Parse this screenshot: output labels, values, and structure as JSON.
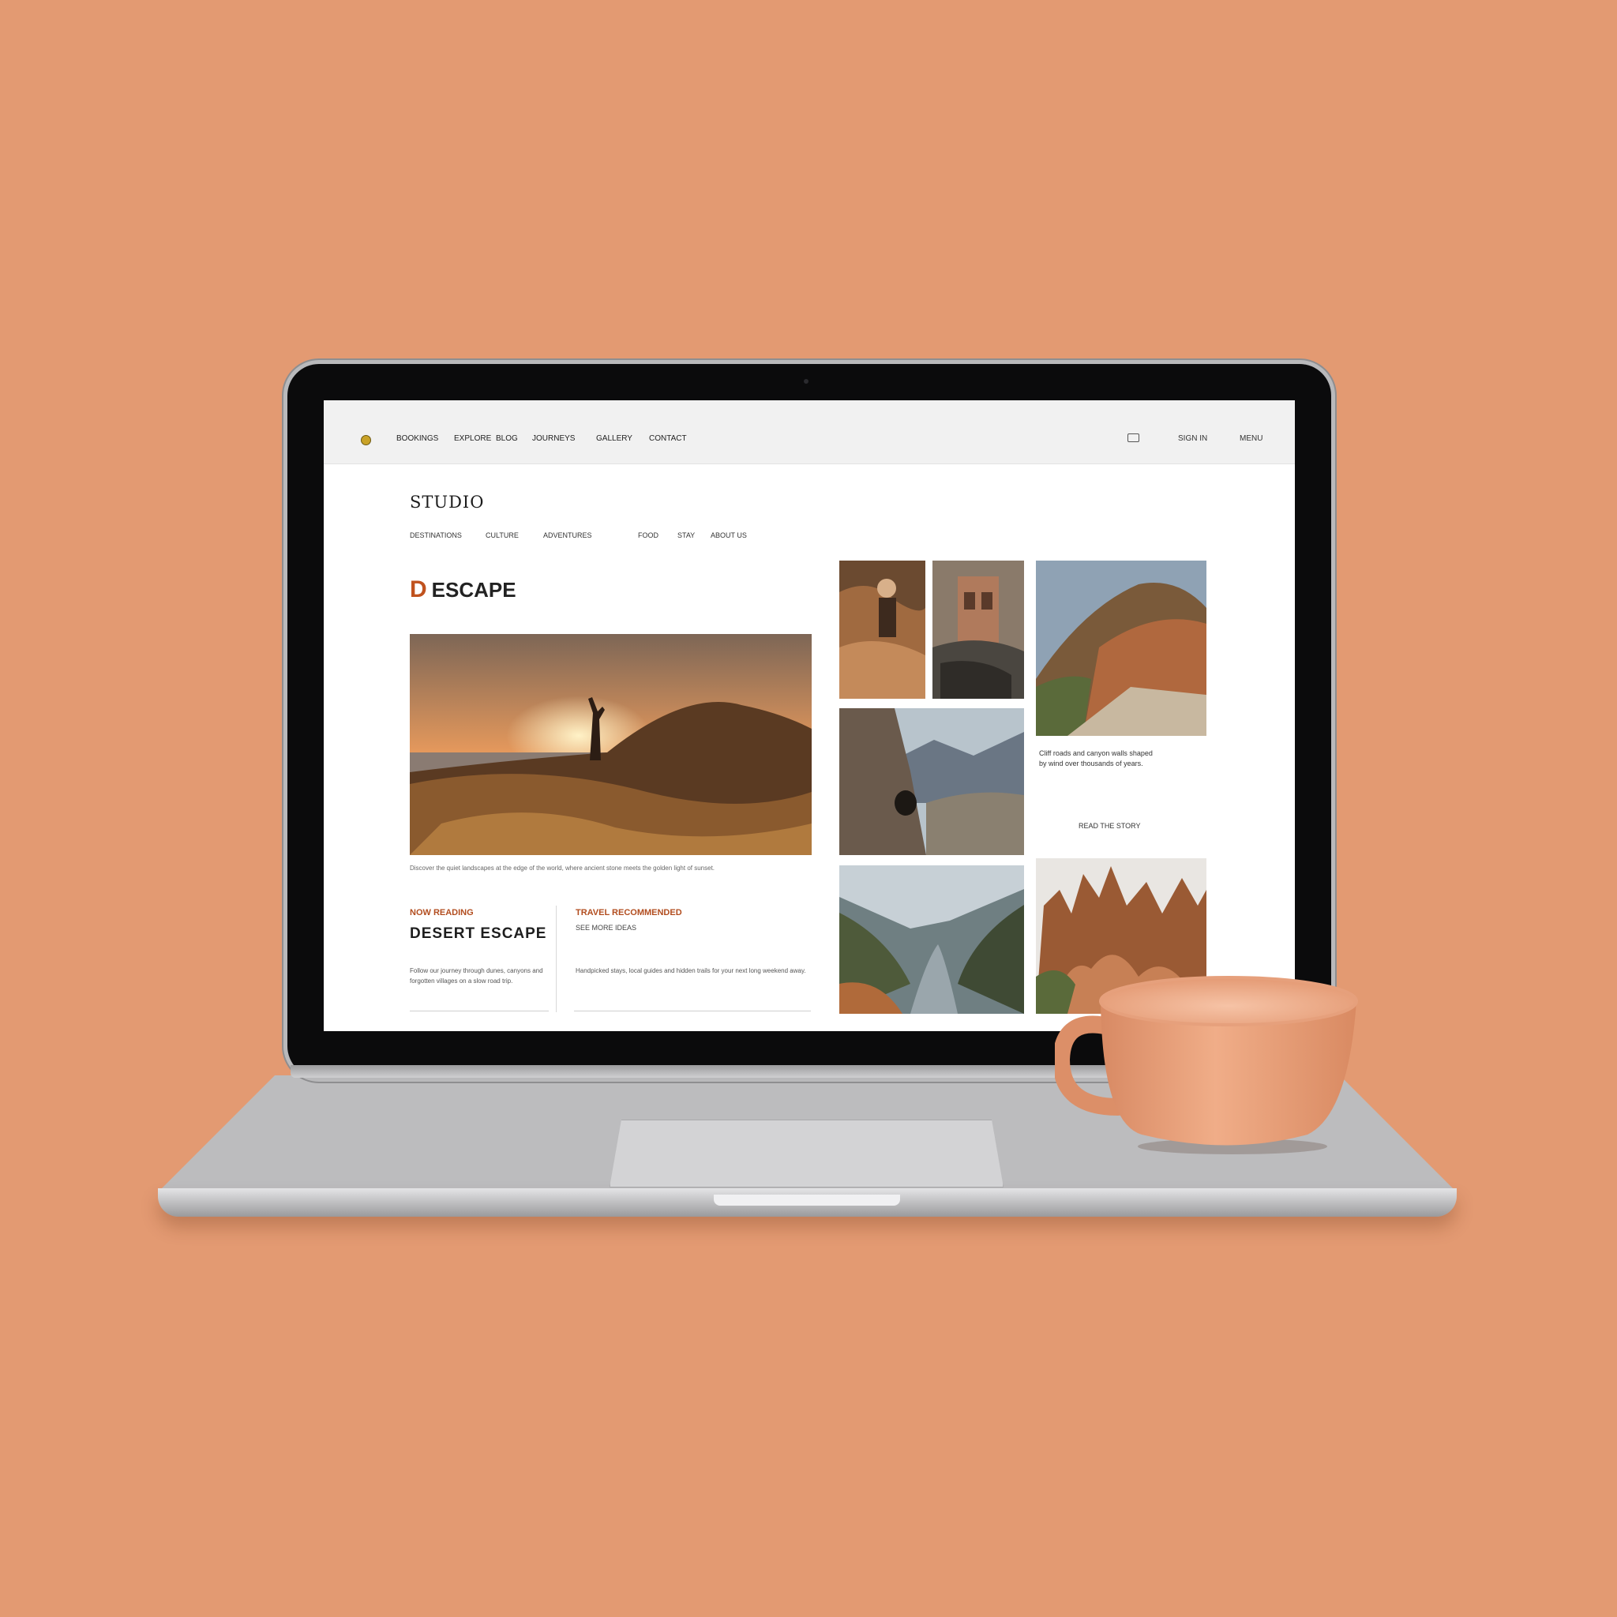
{
  "topbar": {
    "nav": [
      "BOOKINGS",
      "EXPLORE",
      "BLOG",
      "JOURNEYS",
      "GALLERY",
      "CONTACT"
    ],
    "right_items": [
      "SIGN IN",
      "MENU"
    ]
  },
  "site_title": "STUDIO",
  "subnav": [
    "DESTINATIONS",
    "CULTURE",
    "ADVENTURES",
    "FOOD",
    "STAY",
    "ABOUT US"
  ],
  "hero": {
    "accent_letter": "D",
    "heading": "ESCAPE",
    "caption": "Discover the quiet landscapes at the edge of the world, where ancient stone meets the golden light of sunset."
  },
  "cards": [
    {
      "kicker": "NOW READING",
      "title": "DESERT ESCAPE",
      "body": "Follow our journey through dunes, canyons and forgotten villages on a slow road trip."
    },
    {
      "kicker": "TRAVEL RECOMMENDED",
      "subtitle": "SEE MORE IDEAS",
      "body": "Handpicked stays, local guides and hidden trails for your next long weekend away."
    }
  ],
  "side": {
    "text": "Cliff roads and canyon walls shaped by wind over thousands of years.",
    "link": "READ THE STORY"
  },
  "colors": {
    "background": "#e39a72",
    "accent": "#c0521e",
    "mug": "#e8a07c"
  }
}
